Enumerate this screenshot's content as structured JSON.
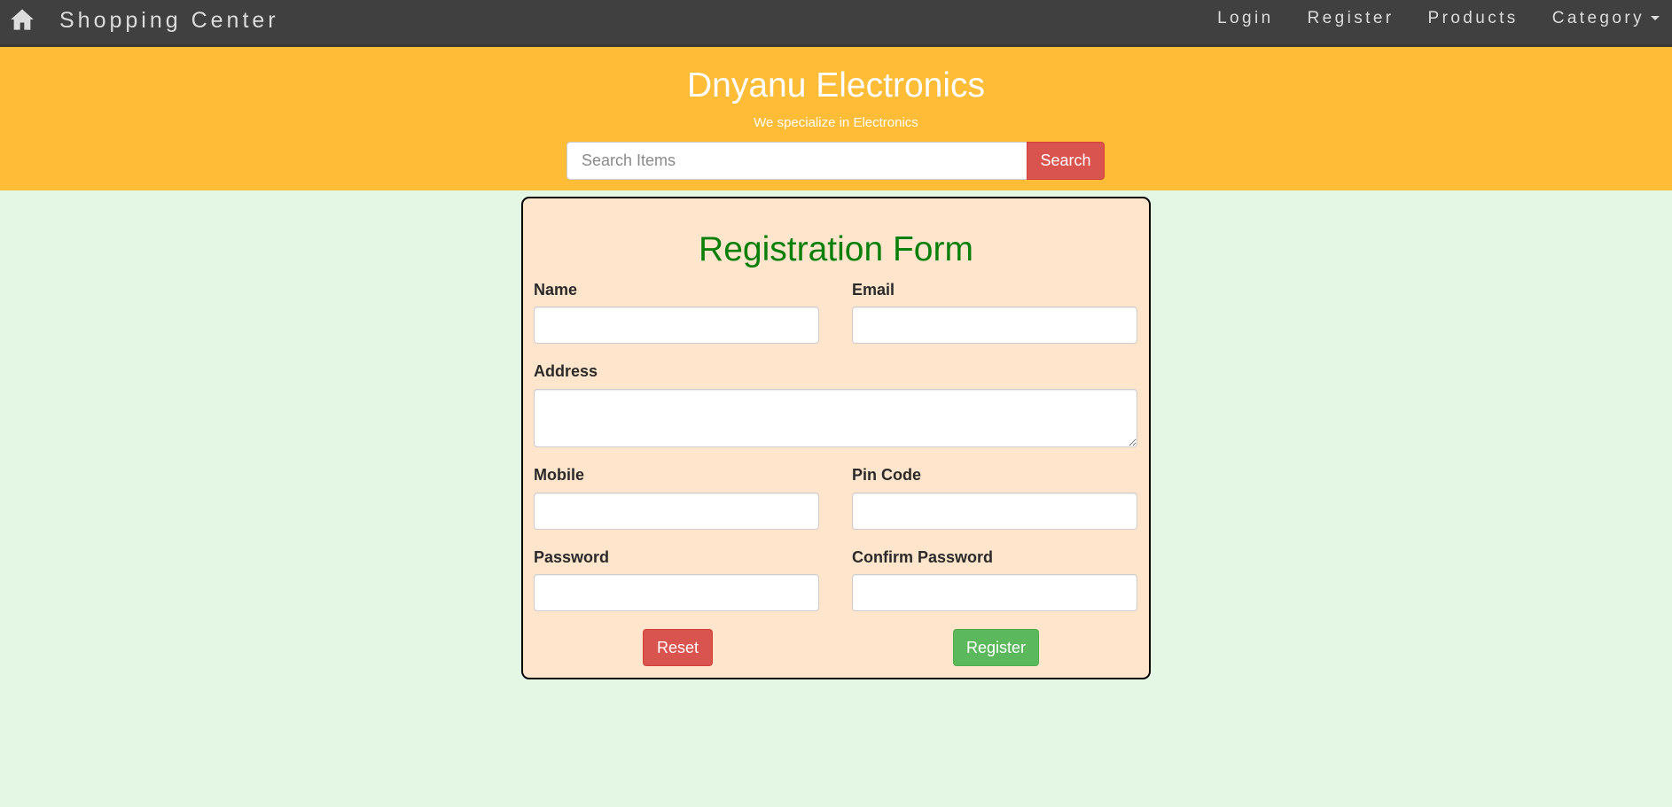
{
  "nav": {
    "home_icon": "home-icon",
    "brand": "Shopping Center",
    "links": [
      "Login",
      "Register",
      "Products",
      "Category"
    ]
  },
  "header": {
    "title": "Dnyanu Electronics",
    "subtitle": "We specialize in Electronics",
    "search_placeholder": "Search Items",
    "search_button": "Search"
  },
  "form": {
    "title": "Registration Form",
    "name_label": "Name",
    "email_label": "Email",
    "address_label": "Address",
    "mobile_label": "Mobile",
    "pincode_label": "Pin Code",
    "password_label": "Password",
    "confirm_label": "Confirm Password",
    "name_value": "",
    "email_value": "",
    "address_value": "",
    "mobile_value": "",
    "pincode_value": "",
    "password_value": "",
    "confirm_value": "",
    "reset_button": "Reset",
    "register_button": "Register"
  },
  "colors": {
    "navbar": "#404040",
    "header": "#ffbc36",
    "page_background": "#e4f7e4",
    "card_background": "#ffe5cc",
    "form_title": "#0a7f0a",
    "danger": "#d9534f",
    "success": "#5cb85c"
  }
}
